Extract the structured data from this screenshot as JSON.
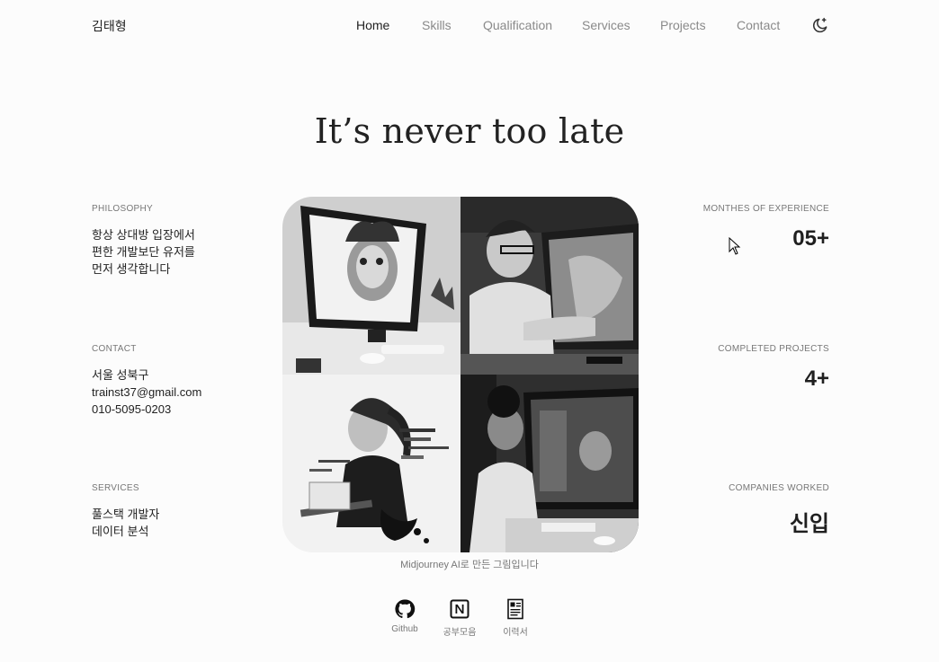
{
  "header": {
    "logo": "김태형",
    "nav": [
      {
        "label": "Home",
        "active": true
      },
      {
        "label": "Skills",
        "active": false
      },
      {
        "label": "Qualification",
        "active": false
      },
      {
        "label": "Services",
        "active": false
      },
      {
        "label": "Projects",
        "active": false
      },
      {
        "label": "Contact",
        "active": false
      }
    ],
    "theme_toggle_icon": "moon-star-icon"
  },
  "hero": {
    "title": "It’s never too late",
    "caption": "Midjourney AI로 만든 그림입니다"
  },
  "left": {
    "philosophy": {
      "label": "PHILOSOPHY",
      "lines": [
        "항상 상대방 입장에서",
        "편한 개발보단 유저를",
        "먼저 생각합니다"
      ]
    },
    "contact": {
      "label": "CONTACT",
      "lines": [
        "서울 성북구",
        "trainst37@gmail.com",
        "010-5095-0203"
      ]
    },
    "services": {
      "label": "SERVICES",
      "lines": [
        "풀스택 개발자",
        "데이터 분석"
      ]
    }
  },
  "right": {
    "experience": {
      "label": "MONTHES OF EXPERIENCE",
      "value": "05+"
    },
    "projects": {
      "label": "COMPLETED PROJECTS",
      "value": "4+"
    },
    "companies": {
      "label": "COMPANIES WORKED",
      "value": "신입"
    }
  },
  "social": [
    {
      "label": "Github",
      "icon": "github-icon"
    },
    {
      "label": "공부모음",
      "icon": "notion-icon"
    },
    {
      "label": "이력서",
      "icon": "resume-icon"
    }
  ],
  "colors": {
    "background": "#fcfcfc",
    "text": "#1f1f1f",
    "muted": "#8a8a8a"
  }
}
